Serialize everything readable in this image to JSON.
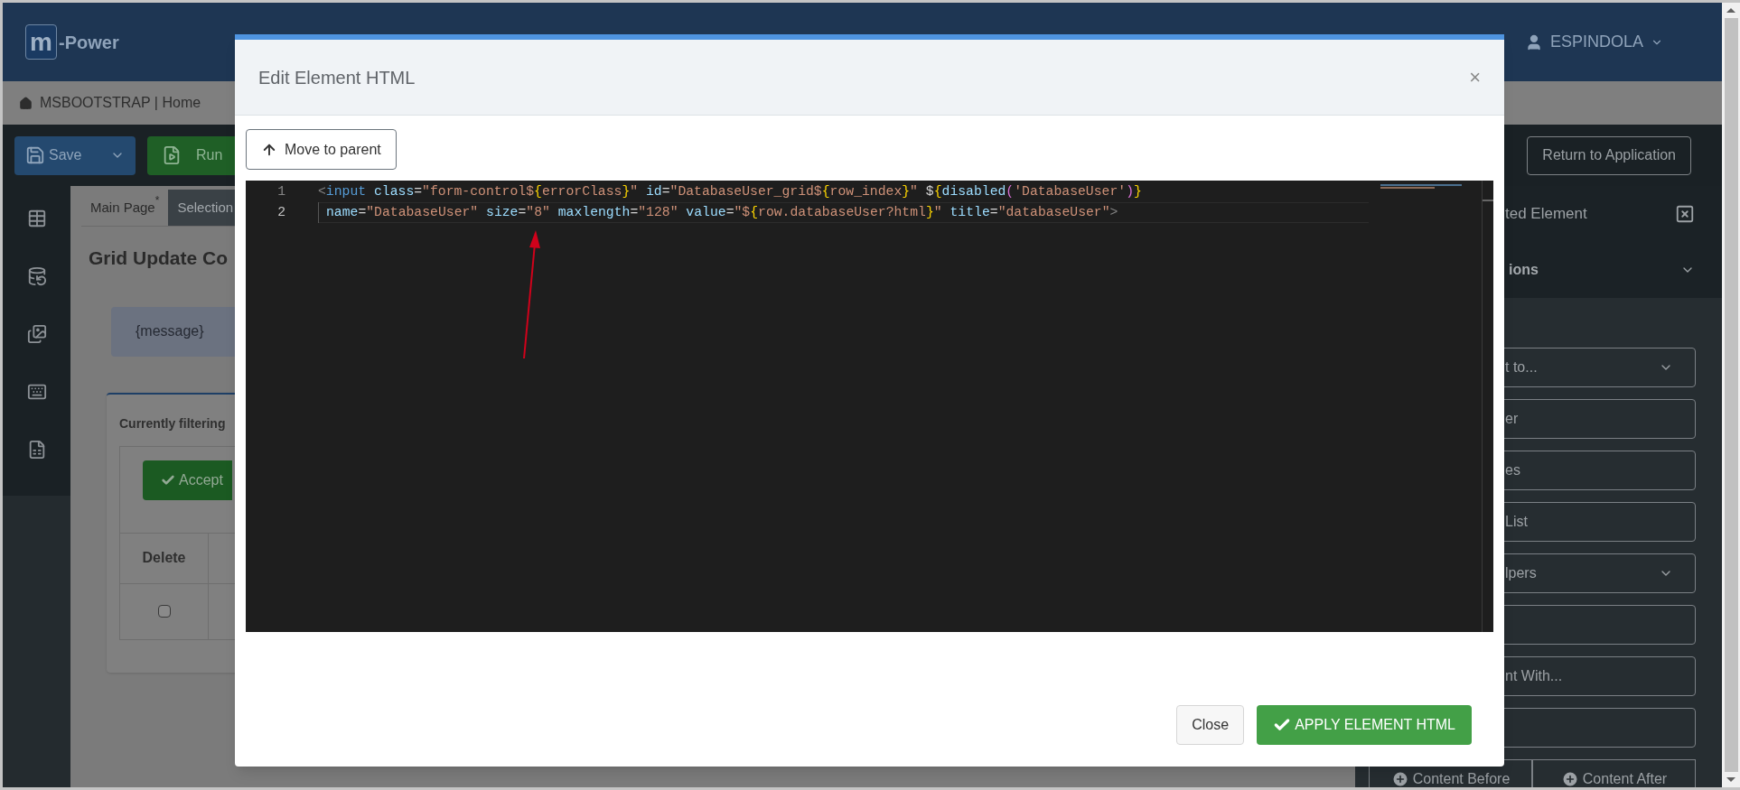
{
  "header": {
    "logo_letter": "m",
    "logo_text": "-Power",
    "user": "ESPINDOLA"
  },
  "breadcrumb": "MSBOOTSTRAP | Home",
  "toolbar": {
    "buttons": [
      {
        "label": "Save",
        "kind": "save"
      },
      {
        "label": "Run",
        "kind": "run"
      }
    ],
    "return_button": "Return to Application"
  },
  "tabs": [
    {
      "label": "Main Page",
      "mark": "*",
      "selected": true
    },
    {
      "label": "Selection",
      "selected": false
    }
  ],
  "page": {
    "title": "Grid Update Co",
    "message": "{message}",
    "filter_card": {
      "title": "Currently filtering",
      "accept_button": "Accept",
      "columns": [
        "Delete"
      ],
      "rows": [
        {
          "checked": false
        }
      ]
    }
  },
  "right_panel": {
    "title": "ted Element",
    "section": "ions",
    "actions": [
      {
        "label": "t to...",
        "kind": "dropdown"
      },
      {
        "label": "er",
        "kind": "plain"
      },
      {
        "label": "es",
        "kind": "plain"
      },
      {
        "label": "List",
        "kind": "plain"
      },
      {
        "label": "lpers",
        "kind": "dropdown"
      },
      {
        "kind": "plain"
      },
      {
        "label": "nt With...",
        "kind": "plain"
      },
      {
        "kind": "plain"
      }
    ],
    "bottom_buttons": [
      "Content Before",
      "Content After"
    ]
  },
  "modal": {
    "title": "Edit Element HTML",
    "close_glyph": "×",
    "move_button": "Move to parent",
    "editor": {
      "lines": [
        {
          "number": "1",
          "selected": false,
          "tokens": [
            {
              "text": "<",
              "kind": "punct"
            },
            {
              "text": "input",
              "kind": "tag"
            },
            {
              "text": " class",
              "kind": "attr"
            },
            {
              "text": "=",
              "kind": "plain"
            },
            {
              "text": "\"form-control$",
              "kind": "string"
            },
            {
              "text": "{",
              "kind": "brace"
            },
            {
              "text": "errorClass",
              "kind": "string"
            },
            {
              "text": "}",
              "kind": "brace"
            },
            {
              "text": "\"",
              "kind": "string"
            },
            {
              "text": " id",
              "kind": "attr"
            },
            {
              "text": "=",
              "kind": "plain"
            },
            {
              "text": "\"DatabaseUser_grid$",
              "kind": "string"
            },
            {
              "text": "{",
              "kind": "brace"
            },
            {
              "text": "row_index",
              "kind": "string"
            },
            {
              "text": "}",
              "kind": "brace"
            },
            {
              "text": "\"",
              "kind": "string"
            },
            {
              "text": " $",
              "kind": "plain"
            },
            {
              "text": "{",
              "kind": "brace"
            },
            {
              "text": "disabled",
              "kind": "attr"
            },
            {
              "text": "(",
              "kind": "paren"
            },
            {
              "text": "'DatabaseUser'",
              "kind": "string"
            },
            {
              "text": ")",
              "kind": "paren"
            },
            {
              "text": "}",
              "kind": "brace"
            }
          ]
        },
        {
          "number": "2",
          "selected": true,
          "tokens": [
            {
              "text": "name",
              "kind": "attr"
            },
            {
              "text": "=",
              "kind": "plain"
            },
            {
              "text": "\"DatabaseUser\"",
              "kind": "string"
            },
            {
              "text": " size",
              "kind": "attr"
            },
            {
              "text": "=",
              "kind": "plain"
            },
            {
              "text": "\"8\"",
              "kind": "string"
            },
            {
              "text": " maxlength",
              "kind": "attr"
            },
            {
              "text": "=",
              "kind": "plain"
            },
            {
              "text": "\"128\"",
              "kind": "string"
            },
            {
              "text": " value",
              "kind": "attr"
            },
            {
              "text": "=",
              "kind": "plain"
            },
            {
              "text": "\"$",
              "kind": "string"
            },
            {
              "text": "{",
              "kind": "brace"
            },
            {
              "text": "row.databaseUser?html",
              "kind": "string"
            },
            {
              "text": "}",
              "kind": "brace"
            },
            {
              "text": "\"",
              "kind": "string"
            },
            {
              "text": " title",
              "kind": "attr"
            },
            {
              "text": "=",
              "kind": "plain"
            },
            {
              "text": "\"databaseUser\"",
              "kind": "string"
            },
            {
              "text": ">",
              "kind": "punct"
            }
          ]
        }
      ]
    },
    "buttons": [
      {
        "label": "Close",
        "kind": "secondary"
      },
      {
        "label": "APPLY ELEMENT HTML",
        "kind": "primary"
      }
    ]
  }
}
